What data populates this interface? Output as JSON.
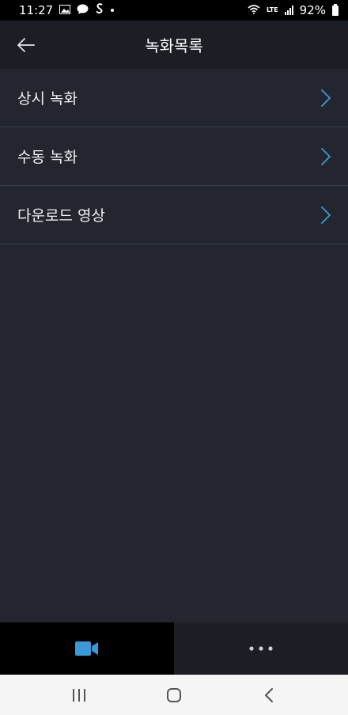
{
  "status_bar": {
    "time": "11:27",
    "network": "LTE",
    "battery": "92%",
    "icons": [
      "gallery-icon",
      "message-icon",
      "talk-icon",
      "s-app-icon",
      "wifi-icon",
      "signal-icon",
      "battery-icon"
    ]
  },
  "app_bar": {
    "title": "녹화목록",
    "back_icon": "arrow-left-icon"
  },
  "menu": {
    "items": [
      {
        "label": "상시 녹화"
      },
      {
        "label": "수동 녹화"
      },
      {
        "label": "다운로드 영상"
      }
    ],
    "chevron_color": "#3a9ad9"
  },
  "bottom_nav": {
    "tabs": [
      {
        "icon": "video-camera-icon",
        "active": true
      },
      {
        "icon": "more-horizontal-icon",
        "active": false
      }
    ],
    "accent": "#3a9ad9"
  },
  "system_nav": {
    "buttons": [
      "recents-icon",
      "home-icon",
      "back-icon"
    ]
  }
}
